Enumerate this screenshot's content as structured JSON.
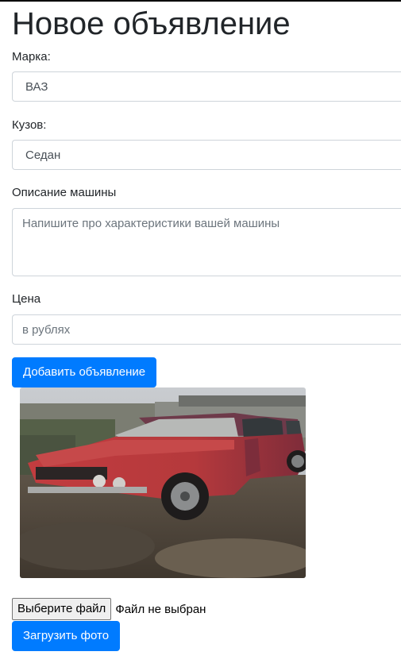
{
  "page": {
    "title": "Новое объявление"
  },
  "form": {
    "brand": {
      "label": "Марка:",
      "value": "ВАЗ"
    },
    "body": {
      "label": "Кузов:",
      "value": "Седан"
    },
    "description": {
      "label": "Описание машины",
      "placeholder": "Напишите про характеристики вашей машины"
    },
    "price": {
      "label": "Цена",
      "placeholder": "в рублях"
    },
    "submit_label": "Добавить объявление"
  },
  "photo": {
    "subject": "red car photo"
  },
  "upload": {
    "choose_file_label": "Выберите файл",
    "file_status": "Файл не выбран",
    "upload_label": "Загрузить фото"
  },
  "colors": {
    "primary": "#007bff",
    "car_red": "#b3343a"
  }
}
